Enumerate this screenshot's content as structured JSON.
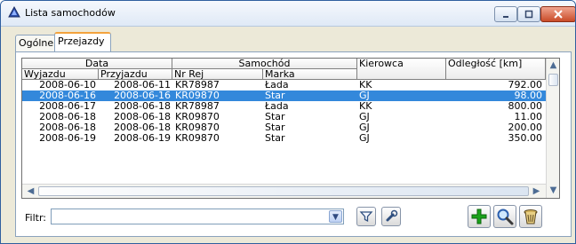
{
  "window": {
    "title": "Lista samochodów",
    "controls": {
      "minimize": "minimize-icon",
      "maximize": "maximize-icon",
      "close": "close-icon"
    }
  },
  "tabs": [
    {
      "label": "Ogólne",
      "active": false
    },
    {
      "label": "Przejazdy",
      "active": true
    }
  ],
  "grid": {
    "groups": {
      "data": "Data",
      "samochod": "Samochód",
      "kierowca": "Kierowca",
      "odleglosc": "Odległość [km]"
    },
    "columns": {
      "wyjazdu": "Wyjazdu",
      "przyjazdu": "Przyjazdu",
      "nr_rej": "Nr Rej",
      "marka": "Marka"
    },
    "rows": [
      {
        "wyjazdu": "2008-06-10",
        "przyjazdu": "2008-06-11",
        "nr_rej": "KR78987",
        "marka": "Łada",
        "kierowca": "KK",
        "odleglosc": "792.00",
        "selected": false
      },
      {
        "wyjazdu": "2008-06-16",
        "przyjazdu": "2008-06-16",
        "nr_rej": "KR09870",
        "marka": "Star",
        "kierowca": "GJ",
        "odleglosc": "98.00",
        "selected": true
      },
      {
        "wyjazdu": "2008-06-17",
        "przyjazdu": "2008-06-18",
        "nr_rej": "KR78987",
        "marka": "Łada",
        "kierowca": "KK",
        "odleglosc": "800.00",
        "selected": false
      },
      {
        "wyjazdu": "2008-06-18",
        "przyjazdu": "2008-06-18",
        "nr_rej": "KR09870",
        "marka": "Star",
        "kierowca": "GJ",
        "odleglosc": "11.00",
        "selected": false
      },
      {
        "wyjazdu": "2008-06-18",
        "przyjazdu": "2008-06-18",
        "nr_rej": "KR09870",
        "marka": "Star",
        "kierowca": "GJ",
        "odleglosc": "200.00",
        "selected": false
      },
      {
        "wyjazdu": "2008-06-19",
        "przyjazdu": "2008-06-19",
        "nr_rej": "KR09870",
        "marka": "Star",
        "kierowca": "GJ",
        "odleglosc": "350.00",
        "selected": false
      }
    ]
  },
  "filter": {
    "label": "Filtr:",
    "value": ""
  },
  "toolbar": {
    "filter_icon": "funnel-icon",
    "settings_icon": "wrench-icon",
    "add_icon": "plus-icon",
    "search_icon": "magnifier-icon",
    "delete_icon": "trash-icon"
  },
  "colors": {
    "title_text": "#000000",
    "selection": "#3388db",
    "active_tab_accent": "#f3a33d",
    "add_icon_green": "#1aa31a"
  }
}
